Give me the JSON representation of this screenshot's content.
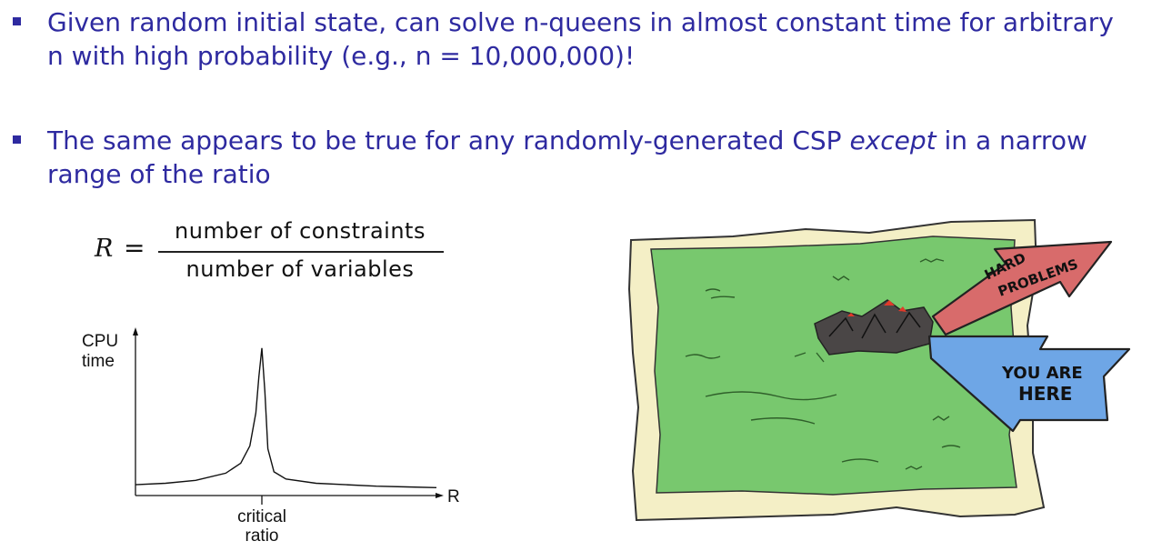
{
  "bullets": [
    {
      "text": "Given random initial state, can solve n-queens in almost constant time for arbitrary n with high probability (e.g., n = 10,000,000)!"
    },
    {
      "text_before": "The same appears to be true for any randomly-generated CSP ",
      "text_italic": "except",
      "text_after": " in a narrow range of the ratio"
    }
  ],
  "formula": {
    "lhs": "R",
    "equals": "=",
    "numerator": "number of constraints",
    "denominator": "number of variables"
  },
  "chart_data": {
    "type": "line",
    "title": "",
    "ylabel_line1": "CPU",
    "ylabel_line2": "time",
    "xlabel": "R",
    "tick_label_line1": "critical",
    "tick_label_line2": "ratio",
    "x": [
      0,
      0.1,
      0.2,
      0.3,
      0.35,
      0.38,
      0.4,
      0.41,
      0.42,
      0.43,
      0.44,
      0.46,
      0.5,
      0.6,
      0.7,
      0.8,
      0.9,
      1.0
    ],
    "series": [
      {
        "values": [
          0.05,
          0.06,
          0.08,
          0.13,
          0.2,
          0.32,
          0.55,
          0.8,
          1.0,
          0.7,
          0.3,
          0.14,
          0.09,
          0.06,
          0.05,
          0.04,
          0.035,
          0.03
        ]
      }
    ],
    "critical_x": 0.42,
    "xlim": [
      0,
      1
    ],
    "ylim": [
      0,
      1.1
    ],
    "grid": false
  },
  "illustration": {
    "sign_top_line1": "HARD",
    "sign_top_line2": "PROBLEMS",
    "sign_bottom_line1": "YOU ARE",
    "sign_bottom_line2": "HERE",
    "colors": {
      "paper": "#f4efc6",
      "grass": "#78c86e",
      "hard_arrow": "#d86b6b",
      "here_arrow": "#6ea6e6",
      "mountains": "#4a4646",
      "lava": "#e03a2a"
    }
  }
}
